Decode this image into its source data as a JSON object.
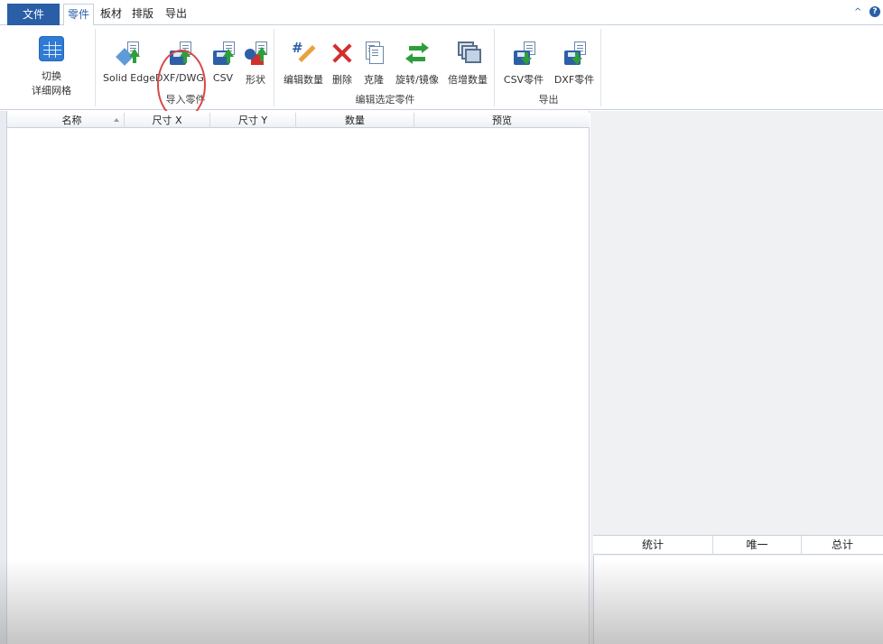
{
  "tabs": {
    "file": "文件",
    "items": [
      "零件",
      "板材",
      "排版",
      "导出"
    ],
    "active": "零件"
  },
  "window_controls": {
    "collapse": "^",
    "help": "?"
  },
  "ribbon": {
    "switch": {
      "line1": "切换",
      "line2": "详细网格"
    },
    "import_group": {
      "label": "导入零件",
      "buttons": [
        "Solid Edge",
        "DXF/DWG",
        "CSV",
        "形状"
      ]
    },
    "edit_group": {
      "label": "编辑选定零件",
      "buttons": [
        "编辑数量",
        "删除",
        "克隆",
        "旋转/镜像",
        "倍增数量"
      ]
    },
    "export_group": {
      "label": "导出",
      "buttons": [
        "CSV零件",
        "DXF零件"
      ]
    }
  },
  "grid": {
    "columns": [
      "名称",
      "尺寸 X",
      "尺寸 Y",
      "数量",
      "预览"
    ]
  },
  "stats": {
    "columns": [
      "统计",
      "唯一",
      "总计"
    ]
  },
  "colors": {
    "accent": "#2a5ea6",
    "highlight": "#d9484a"
  }
}
